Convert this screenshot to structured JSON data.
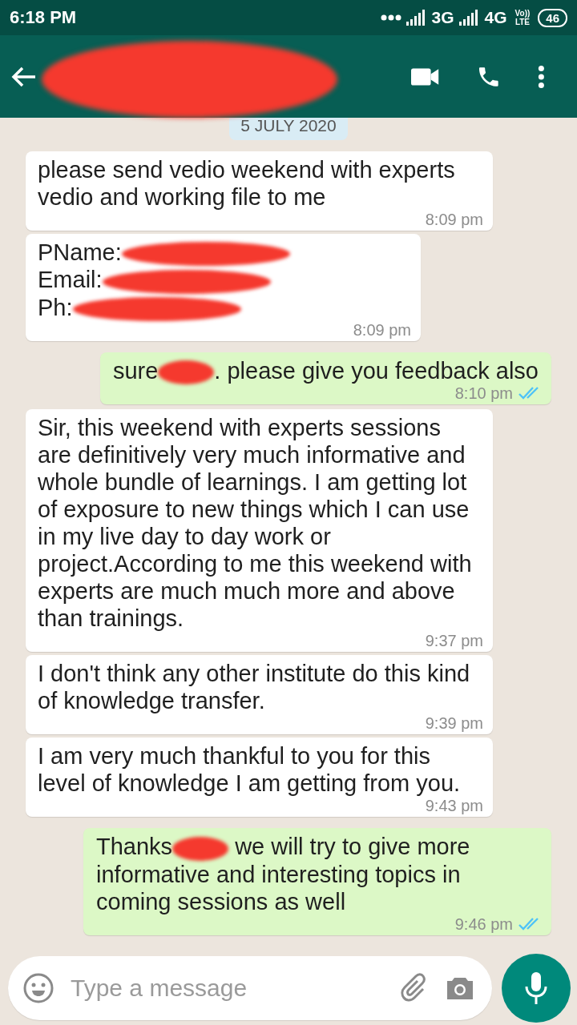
{
  "status_bar": {
    "time": "6:18 PM",
    "network_1": "3G",
    "network_2": "4G",
    "volte_top": "Vo))",
    "volte_bottom": "LTE",
    "battery": "46"
  },
  "header": {
    "title_redacted": true
  },
  "date_chip": "5 JULY 2020",
  "messages": [
    {
      "outgoing": false,
      "parts": [
        {
          "kind": "text",
          "text": "please send vedio weekend with experts vedio and working file to me"
        }
      ],
      "time": "8:09 pm"
    },
    {
      "outgoing": false,
      "parts": [
        {
          "kind": "text",
          "text": "PName:"
        },
        {
          "kind": "redaction"
        },
        {
          "kind": "break"
        },
        {
          "kind": "text",
          "text": "Email:"
        },
        {
          "kind": "redaction"
        },
        {
          "kind": "break"
        },
        {
          "kind": "text",
          "text": "Ph:"
        },
        {
          "kind": "redaction"
        }
      ],
      "time": "8:09 pm"
    },
    {
      "outgoing": true,
      "parts": [
        {
          "kind": "text",
          "text": "sure"
        },
        {
          "kind": "redaction"
        },
        {
          "kind": "text",
          "text": ". please give you feedback also"
        }
      ],
      "time": "8:10 pm",
      "read": true
    },
    {
      "outgoing": false,
      "parts": [
        {
          "kind": "text",
          "text": "Sir, this weekend with experts sessions are definitively very much informative and whole bundle of learnings. I am getting lot of exposure to new things which I can use in my live day to day work or project.According to me this weekend with experts are much much more and above than trainings."
        }
      ],
      "time": "9:37 pm"
    },
    {
      "outgoing": false,
      "parts": [
        {
          "kind": "text",
          "text": "I don't think any other institute do this kind of knowledge transfer."
        }
      ],
      "time": "9:39 pm"
    },
    {
      "outgoing": false,
      "parts": [
        {
          "kind": "text",
          "text": "I am very much thankful to you for this level of knowledge I am getting from you."
        }
      ],
      "time": "9:43 pm"
    },
    {
      "outgoing": true,
      "parts": [
        {
          "kind": "text",
          "text": "Thanks"
        },
        {
          "kind": "redaction"
        },
        {
          "kind": "text",
          "text": " we will try to give more informative and interesting topics in coming sessions as well"
        }
      ],
      "time": "9:46 pm",
      "read": true
    }
  ],
  "composer": {
    "placeholder": "Type a message"
  }
}
